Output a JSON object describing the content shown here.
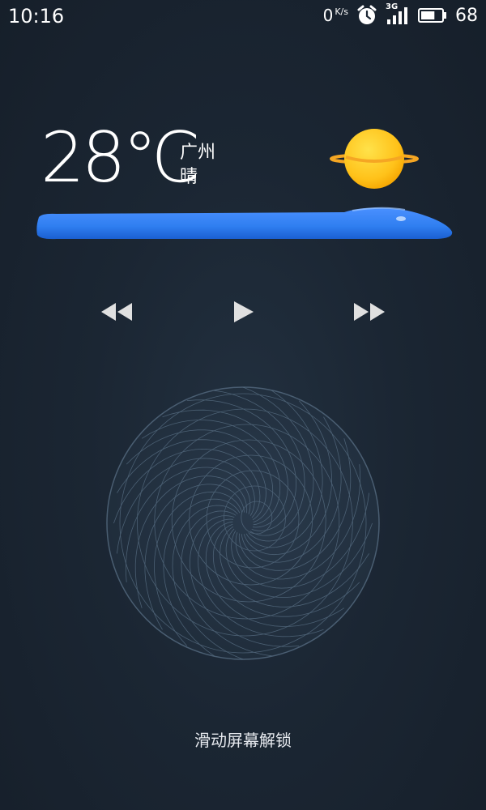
{
  "status_bar": {
    "time": "10:16",
    "net_speed_value": "0",
    "net_speed_unit": "K/s",
    "network_type": "3G",
    "battery_percent": "68",
    "icons": [
      "alarm-icon",
      "signal-icon",
      "battery-icon"
    ]
  },
  "weather": {
    "temperature": "28℃",
    "city": "广州",
    "condition": "晴",
    "icon": "sun-icon",
    "colors": {
      "sun": "#ffc21a",
      "ring": "#f5a623",
      "water": "#2f7ef0"
    }
  },
  "media_controls": {
    "prev_icon": "rewind-icon",
    "play_icon": "play-icon",
    "next_icon": "fast-forward-icon"
  },
  "lock": {
    "hint": "滑动屏幕解锁"
  }
}
